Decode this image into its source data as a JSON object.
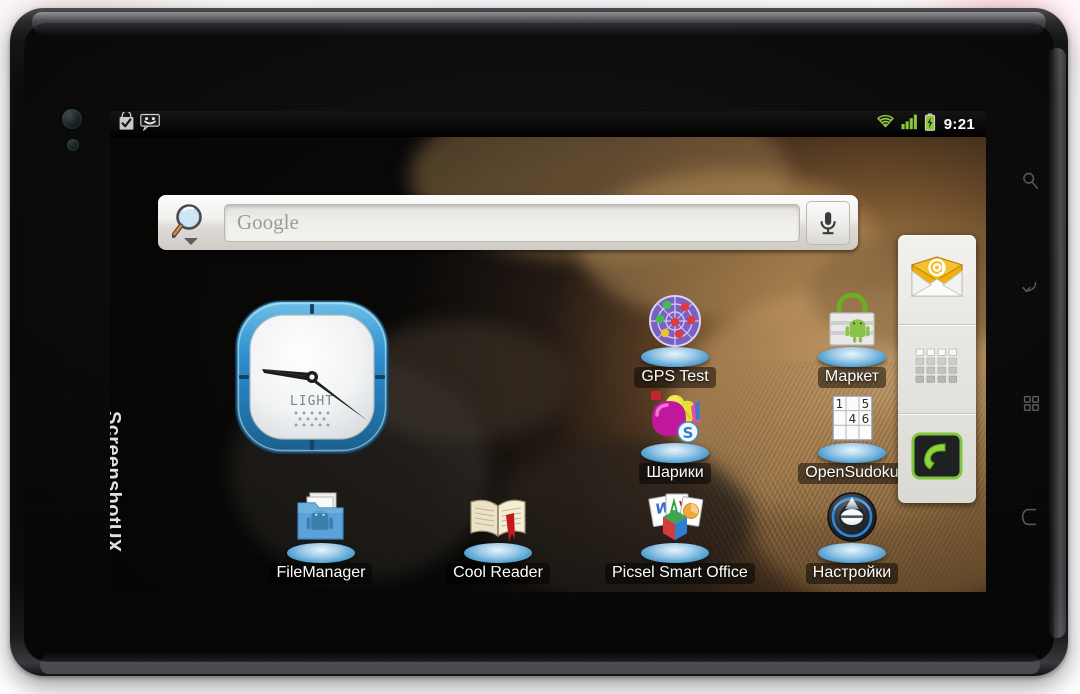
{
  "device": {
    "type": "android-tablet",
    "body_color": "#0a0a0b",
    "hardware_keys": [
      {
        "name": "search",
        "icon": "search-icon"
      },
      {
        "name": "back",
        "icon": "back-arrow-icon"
      },
      {
        "name": "menu",
        "icon": "menu-grid-icon"
      },
      {
        "name": "home",
        "icon": "home-icon"
      }
    ],
    "front_camera": "camera-lens",
    "light_sensor": "light-sensor"
  },
  "statusbar": {
    "notifications": [
      {
        "name": "market-download-complete",
        "icon": "shopping-bag-check-icon"
      },
      {
        "name": "messaging",
        "icon": "smiley-speech-bubble-icon"
      }
    ],
    "wifi": {
      "icon": "wifi-icon",
      "level": 4,
      "color": "#8cc63e"
    },
    "signal": {
      "icon": "signal-bars-icon",
      "bars": 4,
      "color": "#8cc63e"
    },
    "battery": {
      "icon": "battery-charging-icon",
      "charging": true,
      "color": "#8cc63e"
    },
    "time": "9:21"
  },
  "search_widget": {
    "icon": "google-search-magnifier-icon",
    "dropdown_icon": "chevron-down-icon",
    "placeholder": "Google",
    "value": "",
    "voice_icon": "microphone-icon"
  },
  "clock_widget": {
    "name": "analog-clock-widget",
    "brand": "LIGHT",
    "hour": 9,
    "minute": 21,
    "bezel_color": "#2f8fce",
    "face_color": "#f2f4f5"
  },
  "watermark": "ScreenshotUX",
  "apps": [
    {
      "label": "GPS Test",
      "icon": "gps-radar-icon",
      "row": 1,
      "col": 3
    },
    {
      "label": "Маркет",
      "icon": "android-market-icon",
      "row": 1,
      "col": 4
    },
    {
      "label": "Шарики",
      "icon": "balloons-game-icon",
      "row": 2,
      "col": 3
    },
    {
      "label": "OpenSudoku",
      "icon": "sudoku-grid-icon",
      "row": 2,
      "col": 4
    },
    {
      "label": "FileManager",
      "icon": "folder-android-icon",
      "row": 3,
      "col": 1
    },
    {
      "label": "Cool Reader",
      "icon": "open-book-icon",
      "row": 3,
      "col": 2
    },
    {
      "label": "Picsel Smart Office",
      "icon": "documents-cube-icon",
      "row": 3,
      "col": 3
    },
    {
      "label": "Настройки",
      "icon": "settings-dial-icon",
      "row": 3,
      "col": 4
    }
  ],
  "dock": [
    {
      "name": "email",
      "icon": "envelope-at-icon"
    },
    {
      "name": "app-drawer",
      "icon": "app-grid-icon"
    },
    {
      "name": "phone",
      "icon": "phone-handset-icon"
    }
  ],
  "sudoku_cells": [
    "1",
    "",
    "5",
    "",
    "4",
    "6",
    "",
    "",
    ""
  ]
}
